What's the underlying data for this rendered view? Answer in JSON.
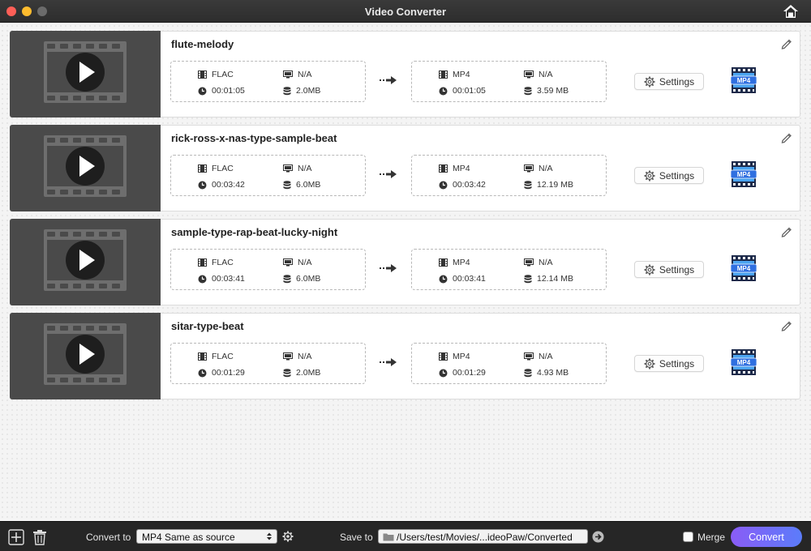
{
  "window": {
    "title": "Video Converter"
  },
  "files": [
    {
      "name": "flute-melody",
      "source": {
        "format": "FLAC",
        "resolution": "N/A",
        "duration": "00:01:05",
        "size": "2.0MB"
      },
      "target": {
        "format": "MP4",
        "resolution": "N/A",
        "duration": "00:01:05",
        "size": "3.59 MB"
      },
      "settings_label": "Settings",
      "badge": "MP4"
    },
    {
      "name": "rick-ross-x-nas-type-sample-beat",
      "source": {
        "format": "FLAC",
        "resolution": "N/A",
        "duration": "00:03:42",
        "size": "6.0MB"
      },
      "target": {
        "format": "MP4",
        "resolution": "N/A",
        "duration": "00:03:42",
        "size": "12.19 MB"
      },
      "settings_label": "Settings",
      "badge": "MP4"
    },
    {
      "name": "sample-type-rap-beat-lucky-night",
      "source": {
        "format": "FLAC",
        "resolution": "N/A",
        "duration": "00:03:41",
        "size": "6.0MB"
      },
      "target": {
        "format": "MP4",
        "resolution": "N/A",
        "duration": "00:03:41",
        "size": "12.14 MB"
      },
      "settings_label": "Settings",
      "badge": "MP4"
    },
    {
      "name": "sitar-type-beat",
      "source": {
        "format": "FLAC",
        "resolution": "N/A",
        "duration": "00:01:29",
        "size": "2.0MB"
      },
      "target": {
        "format": "MP4",
        "resolution": "N/A",
        "duration": "00:01:29",
        "size": "4.93 MB"
      },
      "settings_label": "Settings",
      "badge": "MP4"
    }
  ],
  "bottom": {
    "convert_to_label": "Convert to",
    "convert_to_value": "MP4 Same as source",
    "save_to_label": "Save to",
    "save_path": "/Users/test/Movies/...ideoPaw/Converted",
    "merge_label": "Merge",
    "merge_checked": false,
    "convert_button": "Convert"
  },
  "colors": {
    "accent_start": "#8a5cf6",
    "accent_end": "#5b7cfa",
    "badge_blue": "#2f6fe0"
  }
}
